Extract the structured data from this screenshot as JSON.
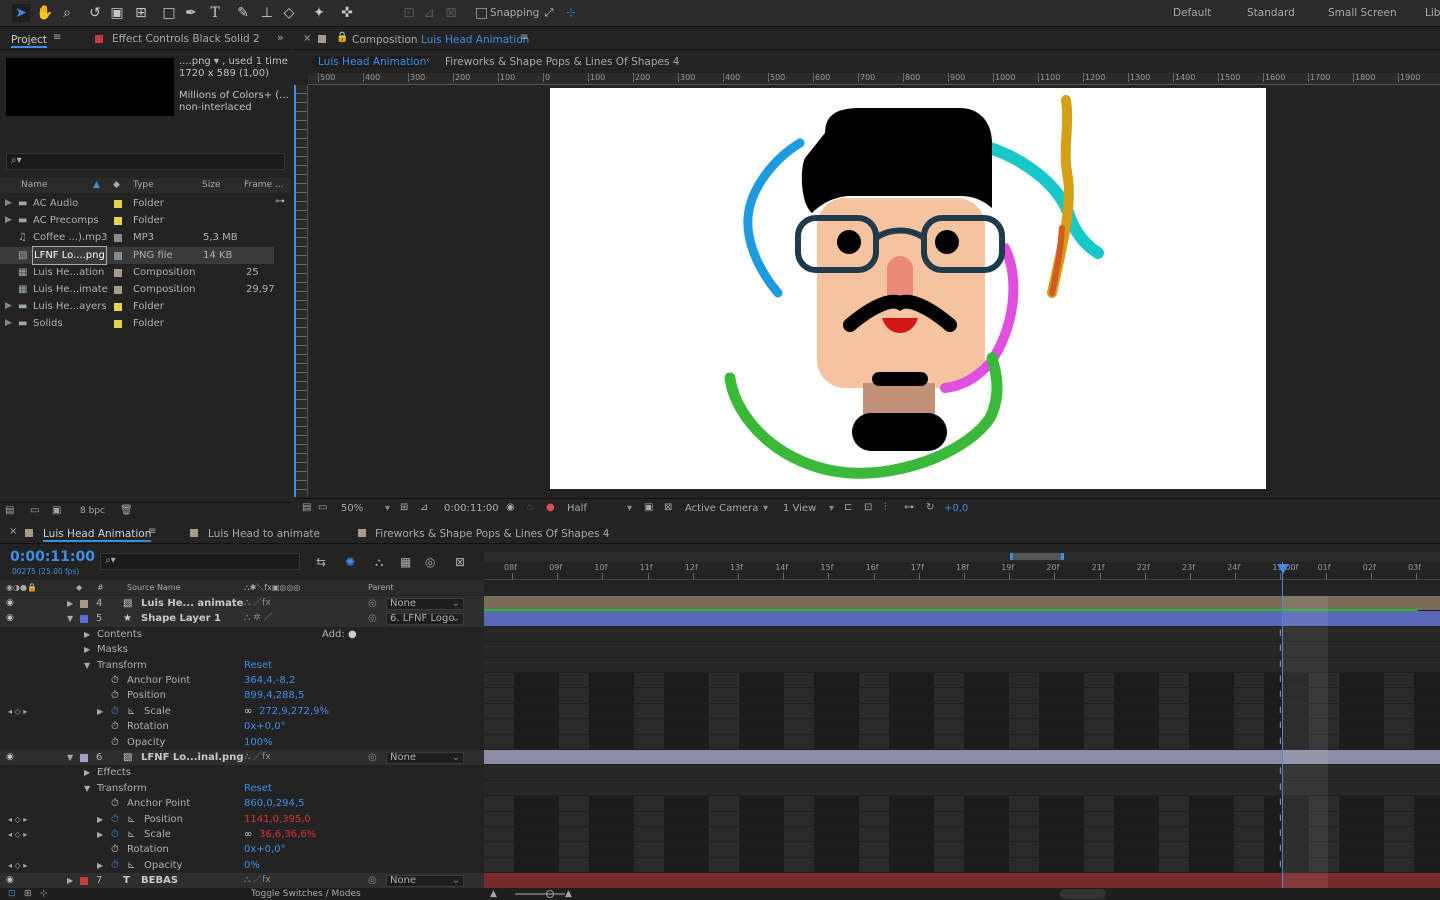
{
  "toolbar": {
    "snapping_label": "Snapping",
    "workspaces": [
      "Default",
      "Standard",
      "Small Screen",
      "Lib"
    ]
  },
  "project_panel": {
    "tab_label": "Project",
    "effect_tab_label": "Effect Controls Black Solid 2",
    "preview_info": {
      "filename": "....png",
      "used": ", used 1 time",
      "dims": "1720 x 589 (1,00)",
      "colors": "Millions of Colors+ (...",
      "interlace": "non-interlaced"
    },
    "columns": {
      "name": "Name",
      "type": "Type",
      "size": "Size",
      "frame": "Frame ..."
    },
    "items": [
      {
        "name": "AC Audio",
        "type": "Folder",
        "size": "",
        "frame": "",
        "label_color": "#e8d44a",
        "icon": "folder-icon"
      },
      {
        "name": "AC Precomps",
        "type": "Folder",
        "size": "",
        "frame": "",
        "label_color": "#e8d44a",
        "icon": "folder-icon"
      },
      {
        "name": "Coffee ...).mp3",
        "type": "MP3",
        "size": "5,3 MB",
        "frame": "",
        "label_color": "#8a8a8a",
        "icon": "audio-file-icon"
      },
      {
        "name": "LFNF Lo....png",
        "type": "PNG file",
        "size": "14 KB",
        "frame": "",
        "label_color": "#8a8a8a",
        "icon": "image-file-icon"
      },
      {
        "name": "Luis He...ation",
        "type": "Composition",
        "size": "",
        "frame": "25",
        "label_color": "#a8998a",
        "icon": "composition-icon"
      },
      {
        "name": "Luis He...imate",
        "type": "Composition",
        "size": "",
        "frame": "29,97",
        "label_color": "#a8998a",
        "icon": "composition-icon"
      },
      {
        "name": "Luis He...ayers",
        "type": "Folder",
        "size": "",
        "frame": "",
        "label_color": "#e8d44a",
        "icon": "folder-icon"
      },
      {
        "name": "Solids",
        "type": "Folder",
        "size": "",
        "frame": "",
        "label_color": "#e8d44a",
        "icon": "folder-icon"
      }
    ],
    "bpc_label": "8 bpc"
  },
  "composition_panel": {
    "tab_prefix": "Composition",
    "tab_name": "Luis Head Animation",
    "flow_tabs": [
      "Luis Head Animation",
      "Fireworks & Shape Pops & Lines Of Shapes 4"
    ],
    "ruler_labels": [
      "500",
      "400",
      "300",
      "200",
      "100",
      "0",
      "100",
      "200",
      "300",
      "400",
      "500",
      "600",
      "700",
      "800",
      "900",
      "1000",
      "1100",
      "1200",
      "1300",
      "1400",
      "1500",
      "1600",
      "1700",
      "1800",
      "1900"
    ],
    "footer": {
      "zoom": "50%",
      "timecode": "0:00:11:00",
      "resolution": "Half",
      "camera": "Active Camera",
      "views": "1 View",
      "exposure": "+0,0"
    }
  },
  "timeline": {
    "tabs": [
      "Luis Head Animation",
      "Luis Head to animate",
      "Fireworks & Shape Pops & Lines Of Shapes 4"
    ],
    "timecode": "0:00:11:00",
    "frame_info": "00275 (25.00 fps)",
    "header": {
      "source_name": "Source Name",
      "parent": "Parent"
    },
    "ruler_labels": [
      "08f",
      "09f",
      "10f",
      "11f",
      "12f",
      "13f",
      "14f",
      "15f",
      "16f",
      "17f",
      "18f",
      "19f",
      "20f",
      "21f",
      "22f",
      "23f",
      "24f",
      "11:00f",
      "01f",
      "02f",
      "03f"
    ],
    "rows": [
      {
        "kind": "layer",
        "num": "4",
        "name": "Luis He... animate",
        "color": "#a8998a",
        "parent": "None",
        "twirl": "▶"
      },
      {
        "kind": "layer",
        "num": "5",
        "name": "Shape Layer 1",
        "color": "#5a72d8",
        "parent": "6. LFNF Logo",
        "twirl": "▼"
      },
      {
        "kind": "group",
        "indent": 1,
        "name": "Contents",
        "extra": "Add:"
      },
      {
        "kind": "group",
        "indent": 1,
        "name": "Masks"
      },
      {
        "kind": "group",
        "indent": 1,
        "name": "Transform",
        "value": "Reset",
        "open": true
      },
      {
        "kind": "prop",
        "name": "Anchor Point",
        "value": "364,4,-8,2"
      },
      {
        "kind": "prop",
        "name": "Position",
        "value": "899,4,288,5"
      },
      {
        "kind": "prop",
        "name": "Scale",
        "value": "272,9,272,9%",
        "keyed": true
      },
      {
        "kind": "prop",
        "name": "Rotation",
        "value": "0x+0,0°"
      },
      {
        "kind": "prop",
        "name": "Opacity",
        "value": "100%"
      },
      {
        "kind": "layer",
        "num": "6",
        "name": "LFNF Lo...inal.png",
        "color": "#a0a0c8",
        "parent": "None",
        "twirl": "▼"
      },
      {
        "kind": "group",
        "indent": 1,
        "name": "Effects"
      },
      {
        "kind": "group",
        "indent": 1,
        "name": "Transform",
        "value": "Reset",
        "open": true
      },
      {
        "kind": "prop",
        "name": "Anchor Point",
        "value": "860,0,294,5"
      },
      {
        "kind": "prop",
        "name": "Position",
        "value": "1141,0,395,0",
        "red": true,
        "keyed": true
      },
      {
        "kind": "prop",
        "name": "Scale",
        "value": "36,6,36,6%",
        "red": true,
        "keyed": true
      },
      {
        "kind": "prop",
        "name": "Rotation",
        "value": "0x+0,0°"
      },
      {
        "kind": "prop",
        "name": "Opacity",
        "value": "0%",
        "keyed": true
      },
      {
        "kind": "layer",
        "num": "7",
        "name": "BEBAS",
        "color": "#c83a3a",
        "parent": "None",
        "twirl": "▶",
        "text": true
      }
    ],
    "footer_label": "Toggle Switches / Modes"
  }
}
